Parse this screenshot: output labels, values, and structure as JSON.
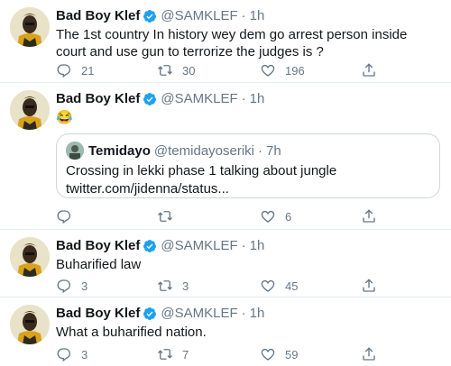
{
  "colors": {
    "text": "#14171a",
    "secondary": "#657786",
    "verified": "#1da1f2",
    "divider": "#e6ecf0"
  },
  "tweets": [
    {
      "name": "Bad Boy Klef",
      "handle": "@SAMKLEF",
      "dot": "·",
      "time": "1h",
      "text": "The 1st country In history wey dem go arrest person inside court and use gun to terrorize the judges is ?",
      "replies": "21",
      "retweets": "30",
      "likes": "196"
    },
    {
      "name": "Bad Boy Klef",
      "handle": "@SAMKLEF",
      "dot": "·",
      "time": "1h",
      "text": "😂",
      "quote": {
        "name": "Temidayo",
        "handle": "@temidayoseriki",
        "dot": "·",
        "time": "7h",
        "text_line1": "Crossing in lekki phase 1 talking about jungle",
        "text_line2": "twitter.com/jidenna/status..."
      },
      "replies": "",
      "retweets": "",
      "likes": "6"
    },
    {
      "name": "Bad Boy Klef",
      "handle": "@SAMKLEF",
      "dot": "·",
      "time": "1h",
      "text": "Buharified law",
      "replies": "3",
      "retweets": "3",
      "likes": "45"
    },
    {
      "name": "Bad Boy Klef",
      "handle": "@SAMKLEF",
      "dot": "·",
      "time": "1h",
      "text": "What a buharified nation.",
      "replies": "3",
      "retweets": "7",
      "likes": "59"
    }
  ]
}
